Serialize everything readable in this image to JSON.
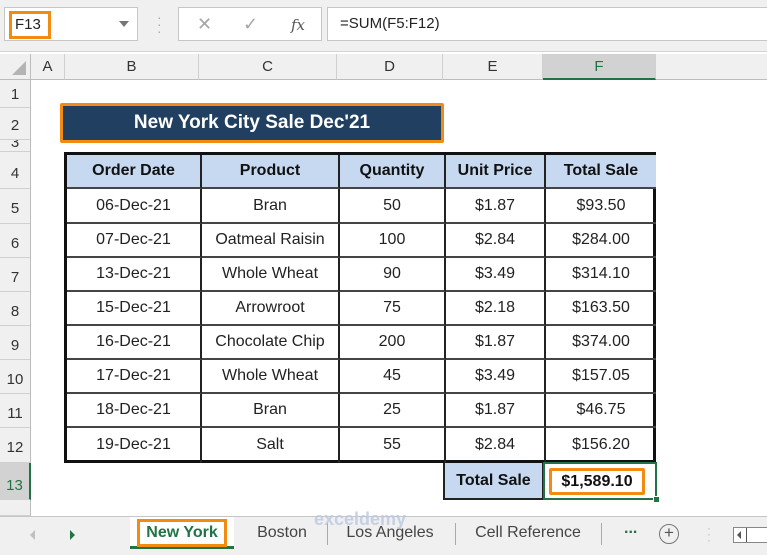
{
  "name_box": {
    "value": "F13"
  },
  "formula_bar": {
    "cancel_icon": "✕",
    "enter_icon": "✓",
    "fx_label": "fx",
    "formula": "=SUM(F5:F12)"
  },
  "columns": [
    "A",
    "B",
    "C",
    "D",
    "E",
    "F"
  ],
  "selected_column": "F",
  "rows": [
    "1",
    "2",
    "3",
    "4",
    "5",
    "6",
    "7",
    "8",
    "9",
    "10",
    "11",
    "12",
    "13"
  ],
  "selected_row": "13",
  "title": "New York City Sale Dec'21",
  "table": {
    "headers": [
      "Order Date",
      "Product",
      "Quantity",
      "Unit Price",
      "Total Sale"
    ],
    "rows": [
      [
        "06-Dec-21",
        "Bran",
        "50",
        "$1.87",
        "$93.50"
      ],
      [
        "07-Dec-21",
        "Oatmeal Raisin",
        "100",
        "$2.84",
        "$284.00"
      ],
      [
        "13-Dec-21",
        "Whole Wheat",
        "90",
        "$3.49",
        "$314.10"
      ],
      [
        "15-Dec-21",
        "Arrowroot",
        "75",
        "$2.18",
        "$163.50"
      ],
      [
        "16-Dec-21",
        "Chocolate Chip",
        "200",
        "$1.87",
        "$374.00"
      ],
      [
        "17-Dec-21",
        "Whole Wheat",
        "45",
        "$3.49",
        "$157.05"
      ],
      [
        "18-Dec-21",
        "Bran",
        "25",
        "$1.87",
        "$46.75"
      ],
      [
        "19-Dec-21",
        "Salt",
        "55",
        "$2.84",
        "$156.20"
      ]
    ],
    "total_label": "Total Sale",
    "total_value": "$1,589.10"
  },
  "sheet_tabs": {
    "tabs": [
      "New York",
      "Boston",
      "Los Angeles",
      "Cell Reference"
    ],
    "active": "New York",
    "more_label": "...",
    "add_label": "+"
  },
  "watermark": "exceldemy",
  "colors": {
    "accent_green": "#217346",
    "highlight_orange": "#f28b12",
    "title_bg": "#203f61",
    "header_bg": "#c6d9f0"
  }
}
